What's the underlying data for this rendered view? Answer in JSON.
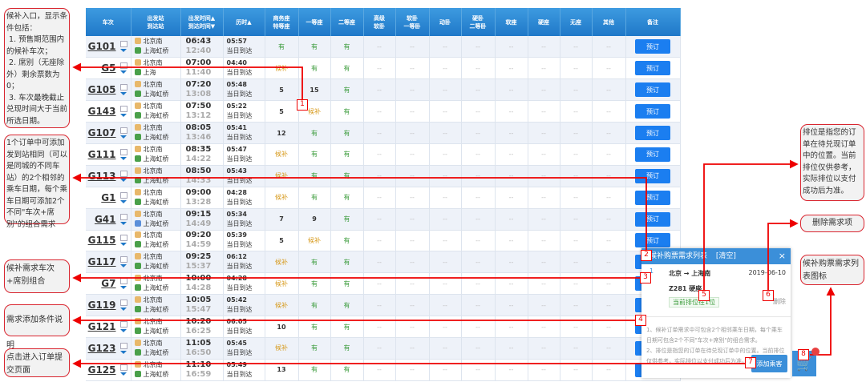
{
  "table": {
    "headers": [
      "车次",
      "出发站\n到达站",
      "出发时间▲\n到达时间▼",
      "历时▲",
      "商务座\n特等座",
      "一等座",
      "二等座",
      "高级\n软卧",
      "软卧\n一等卧",
      "动卧",
      "硬卧\n二等卧",
      "软座",
      "硬座",
      "无座",
      "其他",
      "备注"
    ],
    "book_label": "预订",
    "dash": "--",
    "duration_note": "当日到达",
    "rows": [
      {
        "train": "G101",
        "from": "北京南",
        "to": "上海虹桥",
        "dep": "06:43",
        "arr": "12:40",
        "dur": "05:57",
        "biz": "有",
        "first": "有",
        "second": "有"
      },
      {
        "train": "G5",
        "from": "北京南",
        "to": "上海",
        "dep": "07:00",
        "arr": "11:40",
        "dur": "04:40",
        "biz": "候补",
        "first": "有",
        "second": "有"
      },
      {
        "train": "G105",
        "from": "北京南",
        "to": "上海虹桥",
        "dep": "07:20",
        "arr": "13:08",
        "dur": "05:48",
        "biz": "5",
        "first": "15",
        "second": "有"
      },
      {
        "train": "G143",
        "from": "北京南",
        "to": "上海虹桥",
        "dep": "07:50",
        "arr": "13:12",
        "dur": "05:22",
        "biz": "5",
        "first": "候补",
        "second": "有"
      },
      {
        "train": "G107",
        "from": "北京南",
        "to": "上海虹桥",
        "dep": "08:05",
        "arr": "13:46",
        "dur": "05:41",
        "biz": "12",
        "first": "有",
        "second": "有"
      },
      {
        "train": "G111",
        "from": "北京南",
        "to": "上海虹桥",
        "dep": "08:35",
        "arr": "14:22",
        "dur": "05:47",
        "biz": "候补",
        "first": "有",
        "second": "有"
      },
      {
        "train": "G113",
        "from": "北京南",
        "to": "上海虹桥",
        "dep": "08:50",
        "arr": "14:33",
        "dur": "05:43",
        "biz": "候补",
        "first": "有",
        "second": "有"
      },
      {
        "train": "G1",
        "from": "北京南",
        "to": "上海虹桥",
        "dep": "09:00",
        "arr": "13:28",
        "dur": "04:28",
        "biz": "候补",
        "first": "有",
        "second": "有"
      },
      {
        "train": "G41",
        "from": "北京南",
        "to": "上海虹桥",
        "dep": "09:15",
        "arr": "14:49",
        "dur": "05:34",
        "biz": "7",
        "first": "9",
        "second": "有"
      },
      {
        "train": "G115",
        "from": "北京南",
        "to": "上海虹桥",
        "dep": "09:20",
        "arr": "14:59",
        "dur": "05:39",
        "biz": "5",
        "first": "候补",
        "second": "有"
      },
      {
        "train": "G117",
        "from": "北京南",
        "to": "上海虹桥",
        "dep": "09:25",
        "arr": "15:37",
        "dur": "06:12",
        "biz": "候补",
        "first": "有",
        "second": "有"
      },
      {
        "train": "G7",
        "from": "北京南",
        "to": "上海虹桥",
        "dep": "10:00",
        "arr": "14:28",
        "dur": "04:28",
        "biz": "候补",
        "first": "有",
        "second": "有"
      },
      {
        "train": "G119",
        "from": "北京南",
        "to": "上海虹桥",
        "dep": "10:05",
        "arr": "15:47",
        "dur": "05:42",
        "biz": "候补",
        "first": "有",
        "second": "有"
      },
      {
        "train": "G121",
        "from": "北京南",
        "to": "上海虹桥",
        "dep": "10:20",
        "arr": "16:25",
        "dur": "06:05",
        "biz": "10",
        "first": "有",
        "second": "有"
      },
      {
        "train": "G123",
        "from": "北京南",
        "to": "上海虹桥",
        "dep": "11:05",
        "arr": "16:50",
        "dur": "05:45",
        "biz": "候补",
        "first": "有",
        "second": "有"
      },
      {
        "train": "G125",
        "from": "北京南",
        "to": "上海虹桥",
        "dep": "11:10",
        "arr": "16:59",
        "dur": "05:49",
        "biz": "13",
        "first": "有",
        "second": "有"
      }
    ]
  },
  "popup": {
    "title": "候补购票需求列表",
    "clear": "[清空]",
    "close": "×",
    "item": {
      "index": "1",
      "route": "北京 → 上海南",
      "date": "2019-06-10",
      "train_seat": "Z281 硬座",
      "rank": "当前排位在1位",
      "delete": "删除"
    },
    "notes": "1、候补订单需求中可包含2个相邻乘车日期，每个乘车日期可包含2个不同\"车次+席别\"的组合需求。\n2、排位是指您的订单在待兑现订单中的位置。当前排位仅供参考，实际排位以支付成功后为准。",
    "add_passenger": "添加乘客",
    "cart_icon": "shopping-cart-icon"
  },
  "annotations": {
    "a1": "候补入口，显示条件包括：\n 1. 预售期范围内的候补车次；\n 2. 席别（无座除外）剩余票数为0；\n 3. 车次最晚截止兑现时间大于当前所选日期。",
    "a2": "1个订单中可添加发到站相同（可以是同城的不同车站）的2个相邻的乘车日期，每个乘车日期可添加2个不同\"车次+席别\"的组合需求",
    "a3": "候补需求车次+席别组合",
    "a4": "需求添加条件说明",
    "a7": "点击进入订单提交页面",
    "a5": "排位是指您的订单在待兑现订单中的位置。当前排位仅供参考，实际排位以支付成功后为准。",
    "a6": "删除需求项",
    "a8": "候补购票需求列表图标",
    "markers": [
      "1",
      "2",
      "3",
      "4",
      "5",
      "6",
      "7",
      "8"
    ]
  },
  "colors": {
    "accent": "#1b7ef0",
    "header": "#2b86d2",
    "available": "#3a9b3a",
    "waitlist": "#d79a1c",
    "annotation": "#d9252f"
  }
}
